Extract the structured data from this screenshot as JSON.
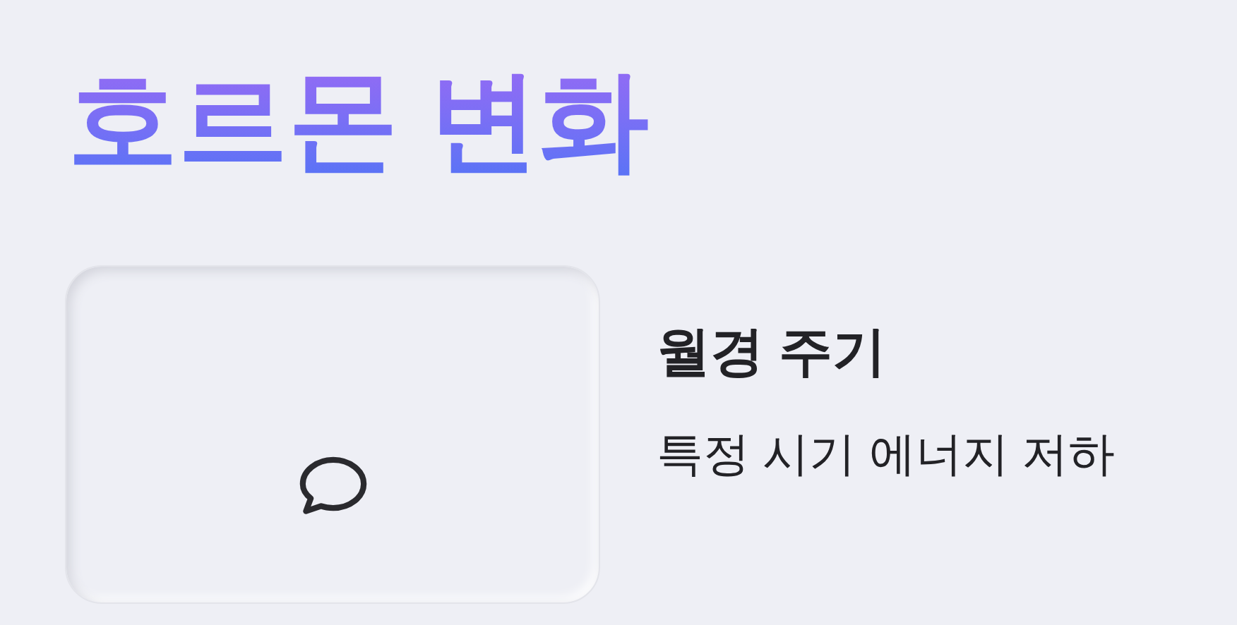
{
  "title": "호르몬 변화",
  "card": {
    "title": "월경 주기",
    "description": "특정 시기 에너지 저하"
  }
}
